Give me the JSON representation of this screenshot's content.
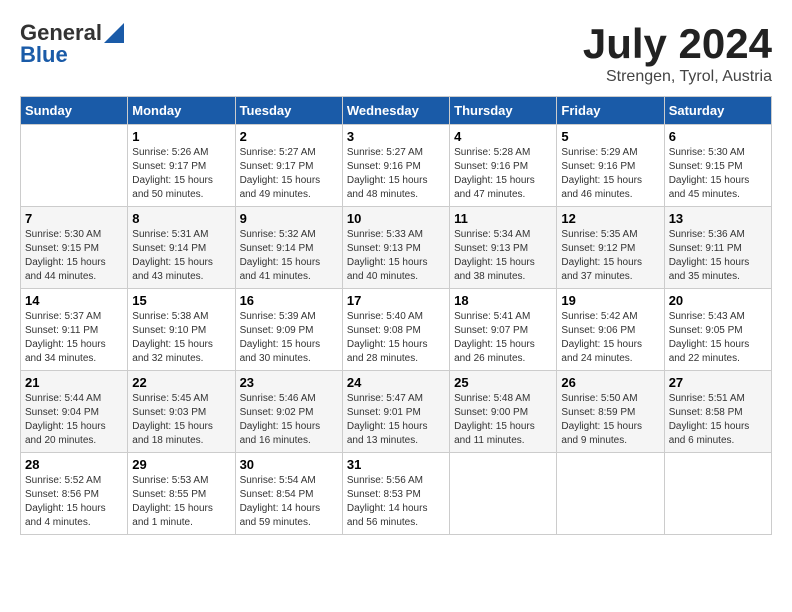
{
  "header": {
    "logo_general": "General",
    "logo_blue": "Blue",
    "month_title": "July 2024",
    "location": "Strengen, Tyrol, Austria"
  },
  "days_of_week": [
    "Sunday",
    "Monday",
    "Tuesday",
    "Wednesday",
    "Thursday",
    "Friday",
    "Saturday"
  ],
  "weeks": [
    [
      {
        "day": "",
        "sunrise": "",
        "sunset": "",
        "daylight": ""
      },
      {
        "day": "1",
        "sunrise": "Sunrise: 5:26 AM",
        "sunset": "Sunset: 9:17 PM",
        "daylight": "Daylight: 15 hours and 50 minutes."
      },
      {
        "day": "2",
        "sunrise": "Sunrise: 5:27 AM",
        "sunset": "Sunset: 9:17 PM",
        "daylight": "Daylight: 15 hours and 49 minutes."
      },
      {
        "day": "3",
        "sunrise": "Sunrise: 5:27 AM",
        "sunset": "Sunset: 9:16 PM",
        "daylight": "Daylight: 15 hours and 48 minutes."
      },
      {
        "day": "4",
        "sunrise": "Sunrise: 5:28 AM",
        "sunset": "Sunset: 9:16 PM",
        "daylight": "Daylight: 15 hours and 47 minutes."
      },
      {
        "day": "5",
        "sunrise": "Sunrise: 5:29 AM",
        "sunset": "Sunset: 9:16 PM",
        "daylight": "Daylight: 15 hours and 46 minutes."
      },
      {
        "day": "6",
        "sunrise": "Sunrise: 5:30 AM",
        "sunset": "Sunset: 9:15 PM",
        "daylight": "Daylight: 15 hours and 45 minutes."
      }
    ],
    [
      {
        "day": "7",
        "sunrise": "Sunrise: 5:30 AM",
        "sunset": "Sunset: 9:15 PM",
        "daylight": "Daylight: 15 hours and 44 minutes."
      },
      {
        "day": "8",
        "sunrise": "Sunrise: 5:31 AM",
        "sunset": "Sunset: 9:14 PM",
        "daylight": "Daylight: 15 hours and 43 minutes."
      },
      {
        "day": "9",
        "sunrise": "Sunrise: 5:32 AM",
        "sunset": "Sunset: 9:14 PM",
        "daylight": "Daylight: 15 hours and 41 minutes."
      },
      {
        "day": "10",
        "sunrise": "Sunrise: 5:33 AM",
        "sunset": "Sunset: 9:13 PM",
        "daylight": "Daylight: 15 hours and 40 minutes."
      },
      {
        "day": "11",
        "sunrise": "Sunrise: 5:34 AM",
        "sunset": "Sunset: 9:13 PM",
        "daylight": "Daylight: 15 hours and 38 minutes."
      },
      {
        "day": "12",
        "sunrise": "Sunrise: 5:35 AM",
        "sunset": "Sunset: 9:12 PM",
        "daylight": "Daylight: 15 hours and 37 minutes."
      },
      {
        "day": "13",
        "sunrise": "Sunrise: 5:36 AM",
        "sunset": "Sunset: 9:11 PM",
        "daylight": "Daylight: 15 hours and 35 minutes."
      }
    ],
    [
      {
        "day": "14",
        "sunrise": "Sunrise: 5:37 AM",
        "sunset": "Sunset: 9:11 PM",
        "daylight": "Daylight: 15 hours and 34 minutes."
      },
      {
        "day": "15",
        "sunrise": "Sunrise: 5:38 AM",
        "sunset": "Sunset: 9:10 PM",
        "daylight": "Daylight: 15 hours and 32 minutes."
      },
      {
        "day": "16",
        "sunrise": "Sunrise: 5:39 AM",
        "sunset": "Sunset: 9:09 PM",
        "daylight": "Daylight: 15 hours and 30 minutes."
      },
      {
        "day": "17",
        "sunrise": "Sunrise: 5:40 AM",
        "sunset": "Sunset: 9:08 PM",
        "daylight": "Daylight: 15 hours and 28 minutes."
      },
      {
        "day": "18",
        "sunrise": "Sunrise: 5:41 AM",
        "sunset": "Sunset: 9:07 PM",
        "daylight": "Daylight: 15 hours and 26 minutes."
      },
      {
        "day": "19",
        "sunrise": "Sunrise: 5:42 AM",
        "sunset": "Sunset: 9:06 PM",
        "daylight": "Daylight: 15 hours and 24 minutes."
      },
      {
        "day": "20",
        "sunrise": "Sunrise: 5:43 AM",
        "sunset": "Sunset: 9:05 PM",
        "daylight": "Daylight: 15 hours and 22 minutes."
      }
    ],
    [
      {
        "day": "21",
        "sunrise": "Sunrise: 5:44 AM",
        "sunset": "Sunset: 9:04 PM",
        "daylight": "Daylight: 15 hours and 20 minutes."
      },
      {
        "day": "22",
        "sunrise": "Sunrise: 5:45 AM",
        "sunset": "Sunset: 9:03 PM",
        "daylight": "Daylight: 15 hours and 18 minutes."
      },
      {
        "day": "23",
        "sunrise": "Sunrise: 5:46 AM",
        "sunset": "Sunset: 9:02 PM",
        "daylight": "Daylight: 15 hours and 16 minutes."
      },
      {
        "day": "24",
        "sunrise": "Sunrise: 5:47 AM",
        "sunset": "Sunset: 9:01 PM",
        "daylight": "Daylight: 15 hours and 13 minutes."
      },
      {
        "day": "25",
        "sunrise": "Sunrise: 5:48 AM",
        "sunset": "Sunset: 9:00 PM",
        "daylight": "Daylight: 15 hours and 11 minutes."
      },
      {
        "day": "26",
        "sunrise": "Sunrise: 5:50 AM",
        "sunset": "Sunset: 8:59 PM",
        "daylight": "Daylight: 15 hours and 9 minutes."
      },
      {
        "day": "27",
        "sunrise": "Sunrise: 5:51 AM",
        "sunset": "Sunset: 8:58 PM",
        "daylight": "Daylight: 15 hours and 6 minutes."
      }
    ],
    [
      {
        "day": "28",
        "sunrise": "Sunrise: 5:52 AM",
        "sunset": "Sunset: 8:56 PM",
        "daylight": "Daylight: 15 hours and 4 minutes."
      },
      {
        "day": "29",
        "sunrise": "Sunrise: 5:53 AM",
        "sunset": "Sunset: 8:55 PM",
        "daylight": "Daylight: 15 hours and 1 minute."
      },
      {
        "day": "30",
        "sunrise": "Sunrise: 5:54 AM",
        "sunset": "Sunset: 8:54 PM",
        "daylight": "Daylight: 14 hours and 59 minutes."
      },
      {
        "day": "31",
        "sunrise": "Sunrise: 5:56 AM",
        "sunset": "Sunset: 8:53 PM",
        "daylight": "Daylight: 14 hours and 56 minutes."
      },
      {
        "day": "",
        "sunrise": "",
        "sunset": "",
        "daylight": ""
      },
      {
        "day": "",
        "sunrise": "",
        "sunset": "",
        "daylight": ""
      },
      {
        "day": "",
        "sunrise": "",
        "sunset": "",
        "daylight": ""
      }
    ]
  ]
}
